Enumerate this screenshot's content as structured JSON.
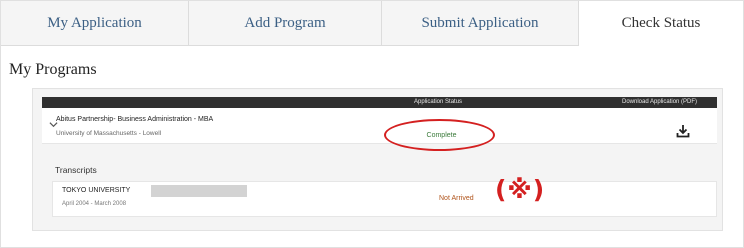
{
  "tabs": [
    {
      "label": "My Application"
    },
    {
      "label": "Add Program"
    },
    {
      "label": "Submit Application"
    },
    {
      "label": "Check Status",
      "active": true
    }
  ],
  "page_title": "My Programs",
  "table_header": {
    "status": "Application Status",
    "download": "Download Application (PDF)"
  },
  "program": {
    "name": "Abitus Partnership- Business Administration - MBA",
    "school": "University of Massachusetts - Lowell",
    "status": "Complete",
    "download_icon": "download-icon"
  },
  "transcripts": {
    "label": "Transcripts",
    "items": [
      {
        "university": "TOKYO UNIVERSITY",
        "dates": "April 2004 - March 2008",
        "status": "Not Arrived"
      }
    ]
  },
  "annotation_mark": "(※)",
  "colors": {
    "tab_text": "#3b5f84",
    "header_bar": "#2f2f2f",
    "complete": "#3a7a3a",
    "not_arrived": "#b0531a",
    "annotation_red": "#d42020"
  }
}
